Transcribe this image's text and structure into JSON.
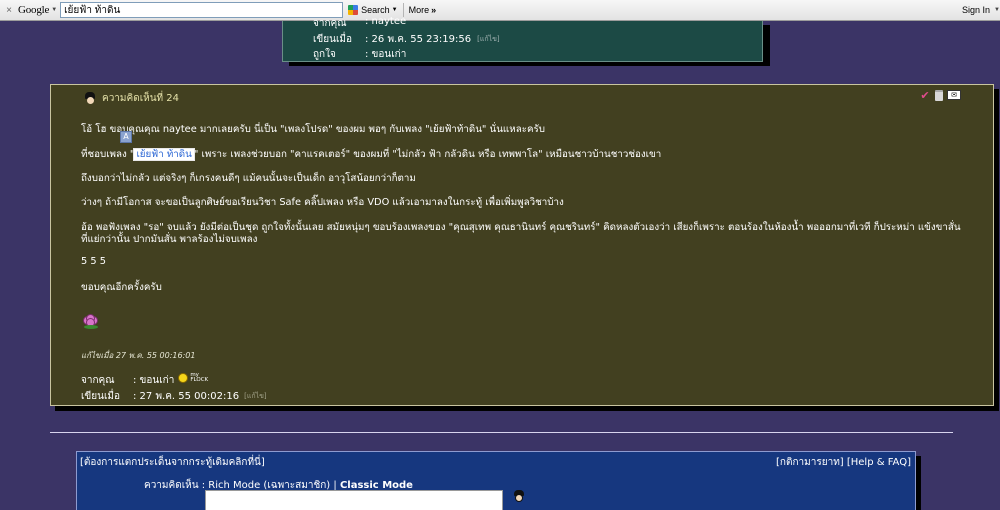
{
  "toolbar": {
    "close": "×",
    "logo": "Google",
    "search_value": "เย้ยฟ้า ท้าดิน",
    "search_button": "Search",
    "more": "More",
    "more_arrows": "»",
    "sign_in": "Sign In"
  },
  "previous_comment": {
    "from_label": "จากคุณ",
    "from_value": ": naytee",
    "written_label": "เขียนเมื่อ",
    "written_value": ": 26 พ.ค. 55 23:19:56",
    "written_edit": "[แก้ไข]",
    "likes_label": "ถูกใจ",
    "likes_value": ": ขอนเก่า"
  },
  "comment": {
    "title": "ความคิดเห็นที่ 24",
    "p1": "โอ้ โฮ  ขอบคุณคุณ naytee มากเลยครับ  นี่เป็น \"เพลงโปรด\" ของผม พอๆ กับเพลง \"เย้ยฟ้าท้าดิน\" นั่นแหละครับ",
    "p2_before": "ที่ชอบเพลง \"",
    "p2_highlight": "เย้ยฟ้า ท้าดิน",
    "p2_after": "\"  เพราะ เพลงช่วยบอก \"คาแรคเตอร์\" ของผมที่ \"ไม่กลัว ฟ้า กลัวดิน หรือ เทพพาโล\" เหมือนชาวบ้านชาวช่องเขา",
    "p3": "ถึงบอกว่าไม่กลัว แต่จริงๆ ก็เกรงคนดีๆ แม้คนนั้นจะเป็นเด็ก อาวุโสน้อยกว่าก็ตาม",
    "p4": "ว่างๆ ถ้ามีโอกาส จะขอเป็นลูกศิษย์ขอเรียนวิชา Safe คลิ๊ปเพลง หรือ VDO แล้วเอามาลงในกระทู้ เพื่อเพิ่มพูลวิชาบ้าง",
    "p5_line1": "อ้อ พอฟังเพลง \"รอ\" จบแล้ว ยังมีต่อเป็นชุด ถูกใจทั้งนั้นเลย  สมัยหนุ่มๆ ขอบร้องเพลงของ \"คุณสุเทพ คุณธานินทร์ คุณชรินทร์\"  คิดหลงตัวเองว่า เสียงก็เพราะ ตอนร้องในห้องน้ำ พอออกมาที่เวที ก็ประหม่า แข้งขาสั่น",
    "p5_line2": "ที่แย่กว่านั้น ปากมันสั่น พาลร้องไม่จบเพลง",
    "p6": "5 5  5",
    "p7": "ขอบคุณอีกครั้งครับ",
    "edited": "แก้ไขเมื่อ 27 พ.ค. 55 00:16:01",
    "from_label": "จากคุณ",
    "from_value": ": ขอนเก่า",
    "badge_my": "my",
    "badge_flock": "FLOCK",
    "written_label": "เขียนเมื่อ",
    "written_value": ": 27 พ.ค. 55 00:02:16",
    "written_edit": "[แก้ไข]"
  },
  "reply": {
    "left_link": "[ต้องการแตกประเด็นจากกระทู้เดิมคลิกที่นี่]",
    "right_links": "[กติกามารยาท] [Help & FAQ]",
    "mode_label": "ความคิดเห็น : Rich Mode (เฉพาะสมาชิก) | ",
    "mode_classic": "Classic Mode"
  },
  "colors": {
    "page_bg": "#3b3466",
    "comment_bg": "#424020",
    "previous_bg": "#1c4a45",
    "reply_bg": "#16377f"
  }
}
